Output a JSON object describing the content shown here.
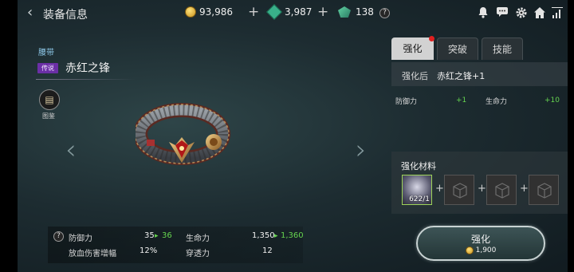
{
  "header": {
    "title": "装备信息",
    "gold": "93,986",
    "gem": "3,987",
    "token": "138"
  },
  "item": {
    "category": "腰带",
    "rarity": "传说",
    "name": "赤红之锋",
    "codex_label": "图鉴"
  },
  "stats": [
    {
      "label": "防御力",
      "value": "35",
      "upgrade": "36"
    },
    {
      "label": "生命力",
      "value": "1,350",
      "upgrade": "1,360"
    },
    {
      "label": "放血伤害增幅",
      "value": "12%"
    },
    {
      "label": "穿透力",
      "value": "12"
    }
  ],
  "tabs": [
    "强化",
    "突破",
    "技能"
  ],
  "enhance": {
    "after_label": "强化后",
    "after_name": "赤红之锋+1",
    "bonus": [
      {
        "label": "防御力",
        "delta": "+1"
      },
      {
        "label": "生命力",
        "delta": "+10"
      }
    ],
    "materials_title": "强化材料",
    "material_count": "622/1",
    "button_label": "强化",
    "cost": "1,900"
  }
}
